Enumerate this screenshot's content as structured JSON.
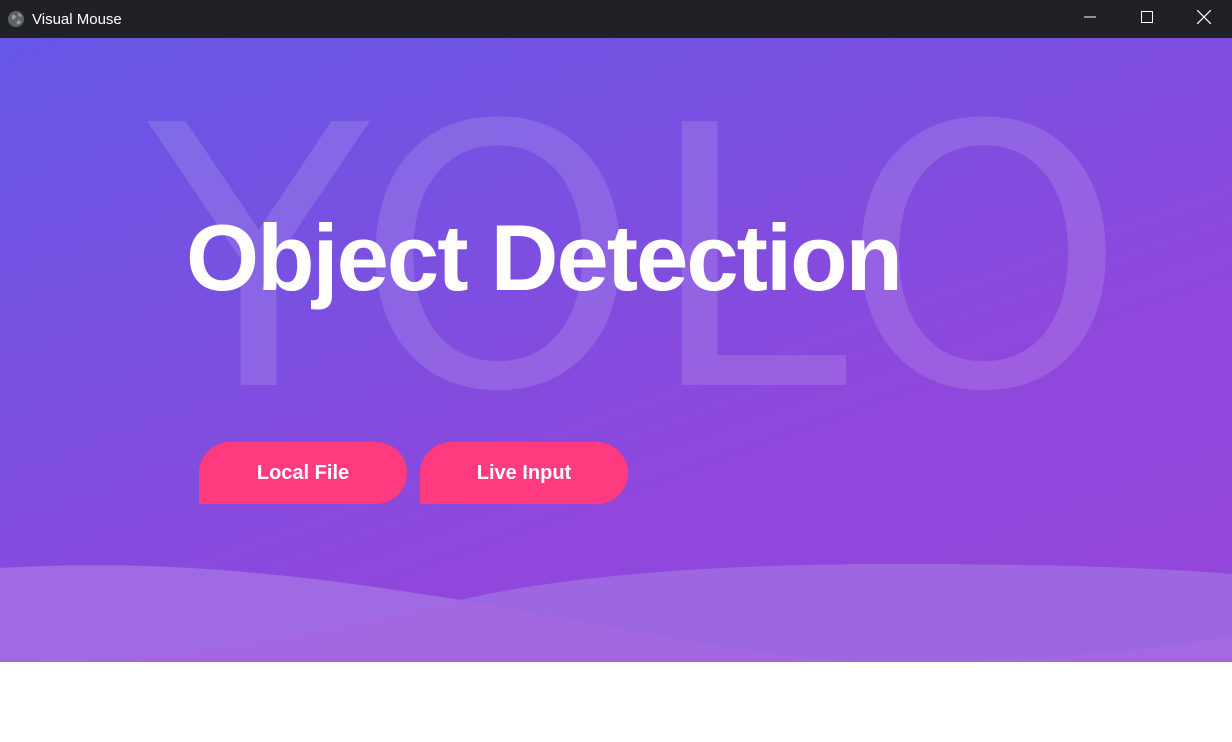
{
  "window": {
    "title": "Visual Mouse",
    "app_icon": "globe-icon",
    "controls": [
      "minimize-icon",
      "maximize-icon",
      "close-icon"
    ]
  },
  "hero": {
    "background_word": "YOLO",
    "title": "Object Detection"
  },
  "buttons": {
    "local_file": "Local File",
    "live_input": "Live Input"
  },
  "colors": {
    "titlebar": "#202124",
    "gradient_start": "#6657e6",
    "gradient_end": "#9447d8",
    "button": "#ff3a7f",
    "wave": "#a56be0",
    "text": "#ffffff"
  }
}
